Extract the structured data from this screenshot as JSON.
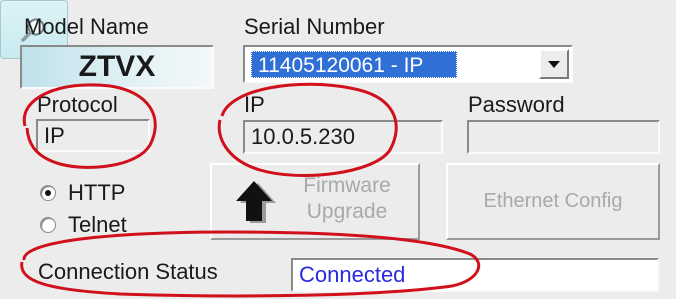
{
  "model": {
    "label": "Model Name",
    "value": "ZTVX"
  },
  "serial": {
    "label": "Serial Number",
    "selected": "11405120061 - IP"
  },
  "protocol": {
    "label": "Protocol",
    "value": "IP"
  },
  "ip": {
    "label": "IP",
    "value": "10.0.5.230"
  },
  "password": {
    "label": "Password",
    "value": ""
  },
  "mode": {
    "options": [
      {
        "label": "HTTP",
        "checked": true
      },
      {
        "label": "Telnet",
        "checked": false
      }
    ]
  },
  "buttons": {
    "firmware_line1": "Firmware",
    "firmware_line2": "Upgrade",
    "ethernet": "Ethernet Config",
    "search_icon": "magnifier-icon"
  },
  "connection": {
    "label": "Connection Status",
    "value": "Connected",
    "value_color": "#2a2ae0"
  },
  "annotation_color": "#d0101a"
}
